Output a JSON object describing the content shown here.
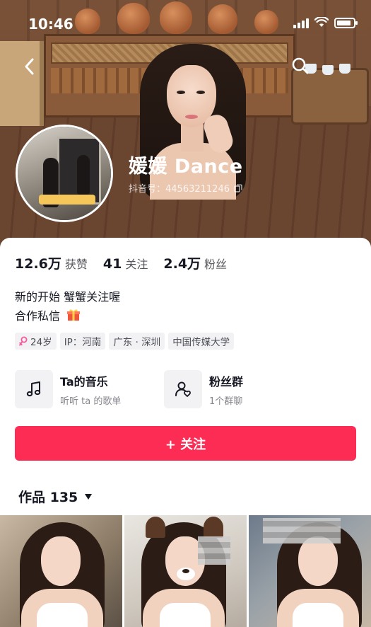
{
  "status_bar": {
    "time": "10:46",
    "battery_level": 0.85
  },
  "profile": {
    "nickname": "媛媛 Dance",
    "douyin_id": "抖音号：44563211246"
  },
  "stats": [
    {
      "value": "12.6万",
      "label": "获赞"
    },
    {
      "value": "41",
      "label": "关注"
    },
    {
      "value": "2.4万",
      "label": "粉丝"
    }
  ],
  "bio": {
    "line1": "新的开始 蟹蟹关注喔",
    "line2": "合作私信"
  },
  "tags": {
    "age": "24岁",
    "ip": "IP：河南",
    "location": "广东 · 深圳",
    "school": "中国传媒大学"
  },
  "cards": {
    "music": {
      "title": "Ta的音乐",
      "sub": "听听 ta 的歌单"
    },
    "fans": {
      "title": "粉丝群",
      "sub": "1个群聊"
    }
  },
  "follow_button": "+ 关注",
  "works": {
    "label": "作品 135"
  },
  "colors": {
    "accent": "#fd2c55",
    "text": "#161823",
    "tag_bg": "#f2f2f4"
  },
  "icons": [
    "back-icon",
    "search-icon",
    "copy-icon",
    "gift-icon",
    "female-icon",
    "music-icon",
    "group-icon",
    "caret-down-icon"
  ]
}
